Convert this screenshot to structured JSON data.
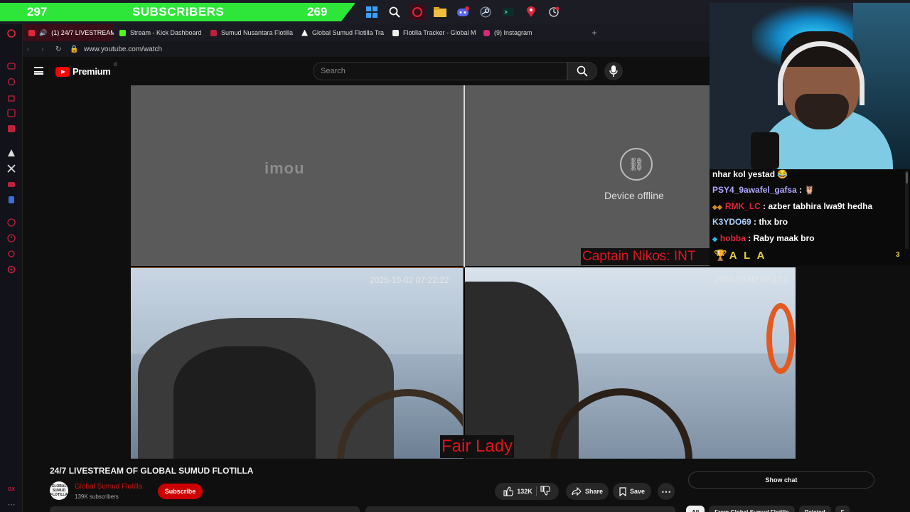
{
  "taskbar": {
    "left_count": "297",
    "banner_label": "SUBSCRIBERS",
    "right_count": "269",
    "icons": [
      "windows-icon",
      "search-icon",
      "opera-gx-icon",
      "folder-icon",
      "discord-icon",
      "steam-icon",
      "terminal-icon",
      "maps-pin-icon",
      "clock-icon"
    ],
    "banner_color": "#2ee63a"
  },
  "browser": {
    "tabs": [
      {
        "label": "(1) 24/7 LIVESTREAM",
        "active": true,
        "favicon": "youtube-icon"
      },
      {
        "label": "Stream - Kick Dashboard",
        "favicon": "kick-icon"
      },
      {
        "label": "Sumud Nusantara Flotilla",
        "favicon": "flotilla-icon"
      },
      {
        "label": "Global Sumud Flotilla Tra",
        "favicon": "triangle-icon"
      },
      {
        "label": "Flotilla Tracker - Global M",
        "favicon": "tracker-icon"
      },
      {
        "label": "(9) Instagram",
        "favicon": "instagram-icon"
      }
    ],
    "new_tab": "+",
    "url": "www.youtube.com/watch",
    "gx_corner": "GX"
  },
  "youtube": {
    "logo_text": "Premium",
    "logo_region": "IT",
    "search_placeholder": "Search",
    "video_title": "24/7 LIVESTREAM OF GLOBAL SUMUD FLOTILLA",
    "channel_name": "Global Sumud Flotilla",
    "channel_avatar_text": "GLOBAL SUMUD FLOTILLA",
    "subscribers": "139K subscribers",
    "subscribe_label": "Subscribe",
    "likes": "132K",
    "share_label": "Share",
    "save_label": "Save",
    "show_chat_label": "Show chat",
    "chips": [
      "All",
      "From Global Sumud Flotilla",
      "Related",
      "F"
    ]
  },
  "video": {
    "cam1_brand": "imou",
    "cam2_status": "Device offline",
    "cam3_timestamp": "2025-10-02 07:22:22",
    "cam4_timestamp": "2025-10-02 07:22:0",
    "label_fair_lady": "Fair Lady",
    "label_captain": "Captain Nikos: INT"
  },
  "chat": {
    "messages": [
      {
        "user": "",
        "text": "nhar kol yestad 😂"
      },
      {
        "user": "PSY4_9awafel_gafsa",
        "text": " : 🦉"
      },
      {
        "user": "RMK_LC",
        "text": " : azber tabhira lwa9t hedha"
      },
      {
        "user": "K3YDO69",
        "text": " : thx bro"
      },
      {
        "user": "hobba",
        "text": " : Raby maak bro"
      }
    ],
    "pinned_name": "A L A",
    "pinned_count": "3"
  }
}
